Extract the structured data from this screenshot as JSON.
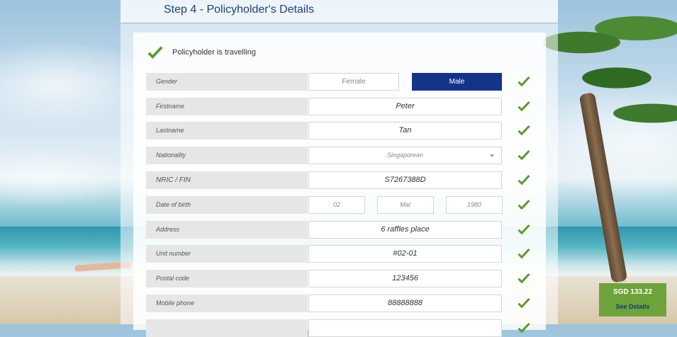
{
  "step": {
    "title": "Step 4 - Policyholder's Details"
  },
  "travelling": {
    "label": "Policyholder is travelling"
  },
  "form": {
    "gender": {
      "label": "Gender",
      "female": "Female",
      "male": "Male",
      "selected": "Male"
    },
    "firstname": {
      "label": "Firstname",
      "value": "Peter"
    },
    "lastname": {
      "label": "Lastname",
      "value": "Tan"
    },
    "nationality": {
      "label": "Nationality",
      "value": "Singaporean"
    },
    "nric": {
      "label": "NRIC / FIN",
      "value": "S7267388D"
    },
    "dob": {
      "label": "Date of birth",
      "day": "02",
      "month": "Mar",
      "year": "1980"
    },
    "address": {
      "label": "Address",
      "value": "6 raffles place"
    },
    "unit": {
      "label": "Unit number",
      "value": "#02-01"
    },
    "postal": {
      "label": "Postal code",
      "value": "123456"
    },
    "mobile": {
      "label": "Mobile phone",
      "value": "88888888"
    }
  },
  "summary": {
    "price": "SGD 133.22",
    "details_link": "See Details"
  },
  "colors": {
    "accent_green": "#6ea33a",
    "male_button": "#14338b",
    "check": "#5b9a2a"
  }
}
